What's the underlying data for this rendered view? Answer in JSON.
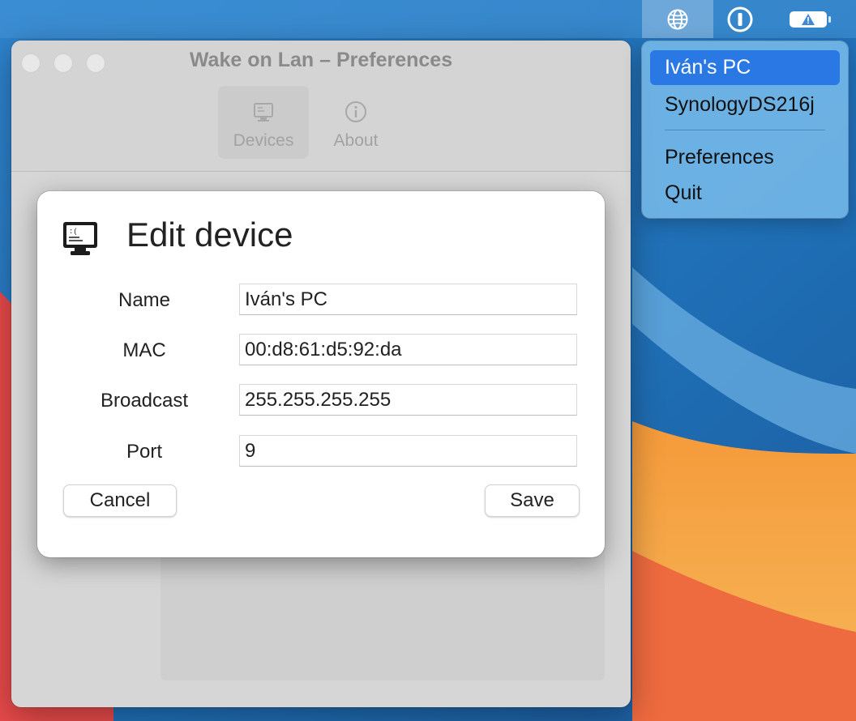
{
  "window": {
    "title": "Wake on Lan – Preferences",
    "tabs": [
      {
        "label": "Devices",
        "icon": "monitor-icon",
        "selected": true
      },
      {
        "label": "About",
        "icon": "info-icon",
        "selected": false
      }
    ]
  },
  "sheet": {
    "title": "Edit device",
    "icon": "monitor-icon",
    "fields": {
      "name": {
        "label": "Name",
        "value": "Iván's PC"
      },
      "mac": {
        "label": "MAC",
        "value": "00:d8:61:d5:92:da"
      },
      "broadcast": {
        "label": "Broadcast",
        "value": "255.255.255.255"
      },
      "port": {
        "label": "Port",
        "value": "9"
      }
    },
    "cancel_label": "Cancel",
    "save_label": "Save"
  },
  "menubar": {
    "items": [
      "globe-icon",
      "one-password-icon",
      "battery-warning-icon"
    ]
  },
  "dropdown": {
    "devices": [
      "Iván's PC",
      "SynologyDS216j"
    ],
    "preferences_label": "Preferences",
    "quit_label": "Quit",
    "highlighted_color": "#2a78e4"
  }
}
